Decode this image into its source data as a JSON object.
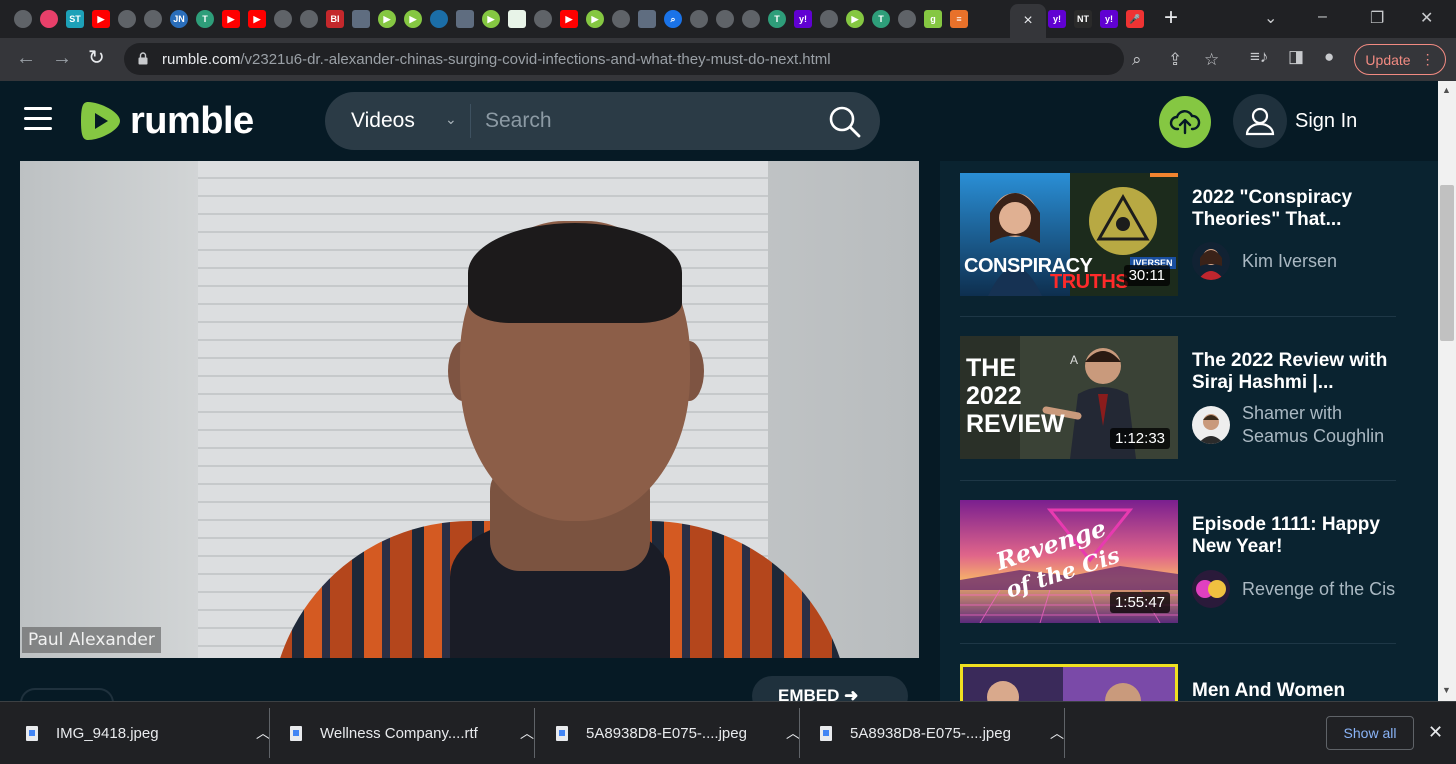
{
  "browser": {
    "url_domain": "rumble.com",
    "url_path": "/v2321u6-dr.-alexander-chinas-surging-covid-infections-and-what-they-must-do-next.html",
    "update_label": "Update",
    "tab_icons": [
      "globe",
      "tennis",
      "st41",
      "youtube",
      "globe",
      "globe",
      "jn",
      "tree",
      "youtube",
      "youtube",
      "globe",
      "globe",
      "bi",
      "flag",
      "rumble",
      "rumble",
      "shield",
      "flag",
      "rumble",
      "grid",
      "globe",
      "youtube",
      "rumble",
      "globe",
      "flag",
      "search",
      "globe",
      "globe",
      "globe",
      "tree",
      "yahoo",
      "globe",
      "rumble",
      "tree",
      "globe",
      "g",
      "bars"
    ],
    "active_tab_close": "×",
    "tabs_after_active": [
      "yahoo",
      "nyt",
      "yahoo",
      "mic"
    ]
  },
  "header": {
    "logo_text": "rumble",
    "search_category": "Videos",
    "search_placeholder": "Search",
    "sign_in_label": "Sign In",
    "brand_color": "#85c742"
  },
  "player": {
    "name_tag": "Paul Alexander",
    "embed_label": "EMBED"
  },
  "related": [
    {
      "title": "2022 \"Conspiracy Theories\" That...",
      "channel": "Kim Iversen",
      "duration": "30:11",
      "thumb_text_1": "CONSPIRACY",
      "thumb_text_2": "TRUTHS",
      "thumb_badge": "IVERSEN"
    },
    {
      "title": "The 2022 Review with Siraj Hashmi |...",
      "channel": "Shamer with Seamus Coughlin",
      "duration": "1:12:33",
      "thumb_text_1": "THE",
      "thumb_text_2": "2022",
      "thumb_text_3": "REVIEW"
    },
    {
      "title": "Episode 1111: Happy New Year!",
      "channel": "Revenge of the Cis",
      "duration": "1:55:47",
      "thumb_text_1": "Revenge",
      "thumb_text_2": "of the Cis"
    },
    {
      "title": "Men And Women",
      "channel": "",
      "duration": ""
    }
  ],
  "downloads": {
    "items": [
      {
        "name": "IMG_9418.jpeg"
      },
      {
        "name": "Wellness Company....rtf"
      },
      {
        "name": "5A8938D8-E075-....jpeg"
      },
      {
        "name": "5A8938D8-E075-....jpeg"
      }
    ],
    "show_all_label": "Show all"
  }
}
